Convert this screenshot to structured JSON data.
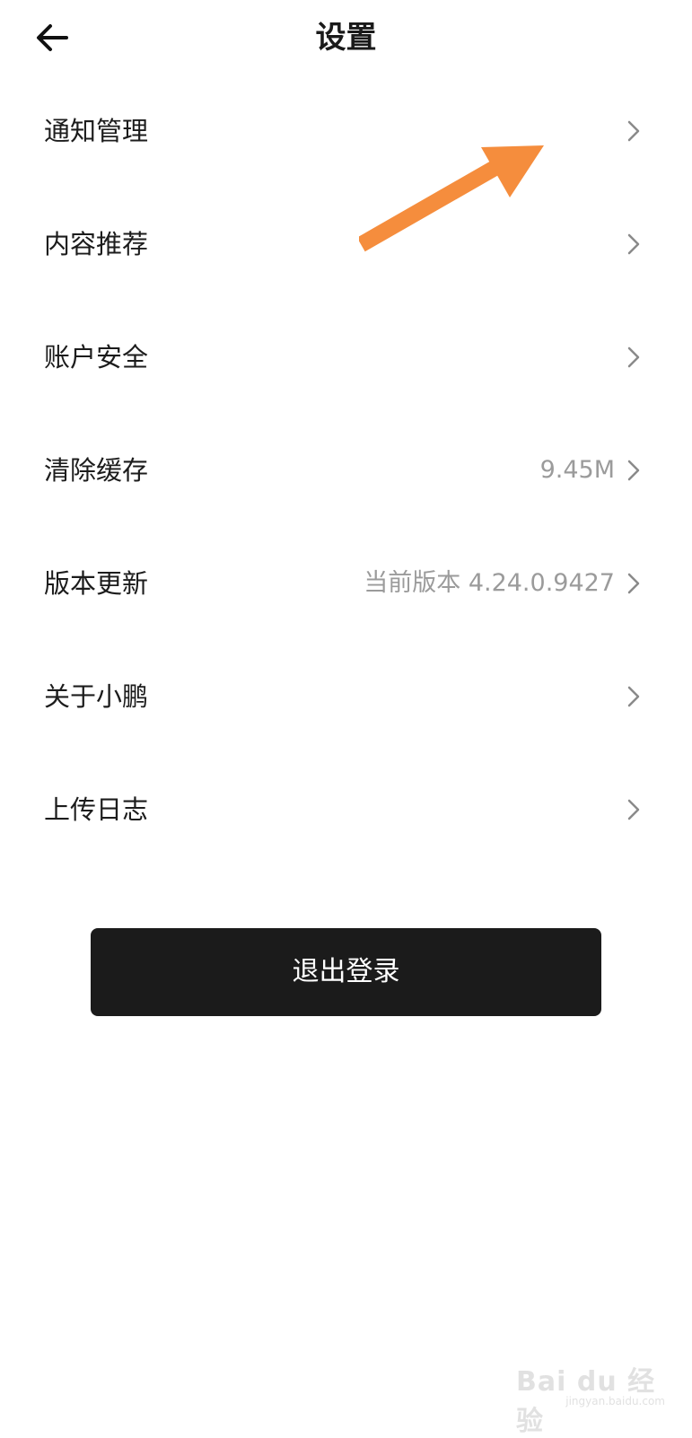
{
  "header": {
    "title": "设置",
    "back_icon": "arrow-left-icon"
  },
  "menu": {
    "items": [
      {
        "label": "通知管理",
        "value": ""
      },
      {
        "label": "内容推荐",
        "value": ""
      },
      {
        "label": "账户安全",
        "value": ""
      },
      {
        "label": "清除缓存",
        "value": "9.45M"
      },
      {
        "label": "版本更新",
        "value": "当前版本 4.24.0.9427"
      },
      {
        "label": "关于小鹏",
        "value": ""
      },
      {
        "label": "上传日志",
        "value": ""
      }
    ],
    "chevron_icon": "chevron-right-icon"
  },
  "logout": {
    "label": "退出登录"
  },
  "annotation": {
    "icon": "orange-arrow-icon",
    "color": "#F58D3D"
  },
  "watermark": {
    "main": "Bai du 经验",
    "sub": "jingyan.baidu.com"
  },
  "colors": {
    "background": "#FFFFFF",
    "text": "#1C1C1C",
    "secondary_text": "#9B9B9B",
    "button": "#1B1B1B",
    "button_text": "#FFFFFF"
  }
}
